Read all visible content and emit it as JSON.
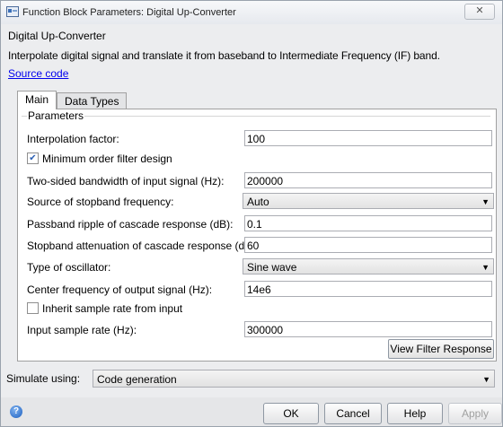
{
  "window": {
    "title": "Function Block Parameters: Digital Up-Converter",
    "close_label": "✕"
  },
  "block": {
    "name": "Digital Up-Converter",
    "description": "Interpolate digital signal and translate it from baseband to Intermediate Frequency (IF) band.",
    "source_link": "Source code"
  },
  "tabs": [
    {
      "label": "Main",
      "selected": true
    },
    {
      "label": "Data Types",
      "selected": false
    }
  ],
  "parameters": {
    "group_label": "Parameters",
    "interpolation_factor": {
      "label": "Interpolation factor:",
      "value": "100"
    },
    "min_order": {
      "label": "Minimum order filter design",
      "checked": true
    },
    "bandwidth": {
      "label": "Two-sided bandwidth of input signal (Hz):",
      "value": "200000"
    },
    "stopband_source": {
      "label": "Source of stopband frequency:",
      "value": "Auto"
    },
    "passband_ripple": {
      "label": "Passband ripple of cascade response (dB):",
      "value": "0.1"
    },
    "stopband_atten": {
      "label": "Stopband attenuation of cascade response (dB):",
      "value": "60"
    },
    "oscillator_type": {
      "label": "Type of oscillator:",
      "value": "Sine wave"
    },
    "center_freq": {
      "label": "Center frequency of output signal (Hz):",
      "value": "14e6"
    },
    "inherit_rate": {
      "label": "Inherit sample rate from input",
      "checked": false
    },
    "input_rate": {
      "label": "Input sample rate (Hz):",
      "value": "300000"
    },
    "view_filter_label": "View Filter Response"
  },
  "simulate": {
    "label": "Simulate using:",
    "value": "Code generation"
  },
  "footer": {
    "help_glyph": "?",
    "ok": "OK",
    "cancel": "Cancel",
    "help": "Help",
    "apply": "Apply"
  },
  "icons": {
    "dropdown": "▼",
    "check": "✔"
  }
}
